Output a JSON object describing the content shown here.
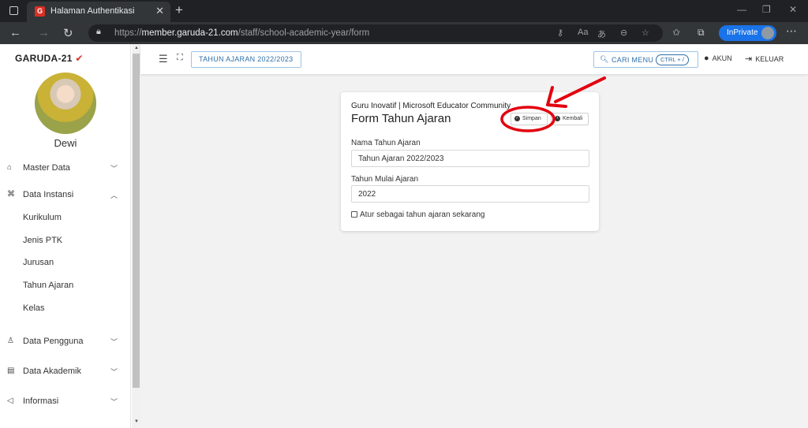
{
  "browser": {
    "tab_title": "Halaman Authentikasi",
    "url_prefix": "https://",
    "url_host": "member.garuda-21.com",
    "url_path": "/staff/school-academic-year/form",
    "inprivate_label": "InPrivate"
  },
  "sidebar": {
    "brand": "GARUDA-21",
    "username": "Dewi",
    "items": [
      {
        "label": "Master Data",
        "icon": "home-icon",
        "expanded": false
      },
      {
        "label": "Data Instansi",
        "icon": "institution-icon",
        "expanded": true
      },
      {
        "label": "Data Pengguna",
        "icon": "user-icon",
        "expanded": false
      },
      {
        "label": "Data Akademik",
        "icon": "book-icon",
        "expanded": false
      },
      {
        "label": "Informasi",
        "icon": "megaphone-icon",
        "expanded": false
      }
    ],
    "subitems": [
      "Kurikulum",
      "Jenis PTK",
      "Jurusan",
      "Tahun Ajaran",
      "Kelas"
    ]
  },
  "topbar": {
    "year_button": "TAHUN AJARAN 2022/2023",
    "search_label": "CARI MENU",
    "search_shortcut": "CTRL + /",
    "account_label": "AKUN",
    "logout_label": "KELUAR"
  },
  "form": {
    "org": "Guru Inovatif | Microsoft Educator Community",
    "title": "Form Tahun Ajaran",
    "save_label": "Simpan",
    "back_label": "Kembali",
    "name_label": "Nama Tahun Ajaran",
    "name_value": "Tahun Ajaran 2022/2023",
    "start_label": "Tahun Mulai Ajaran",
    "start_value": "2022",
    "checkbox_label": "Atur sebagai tahun ajaran sekarang",
    "checkbox_checked": false
  },
  "colors": {
    "accent": "#2f6fa8",
    "annotation": "#e3000f",
    "inprivate": "#1a73e8"
  }
}
